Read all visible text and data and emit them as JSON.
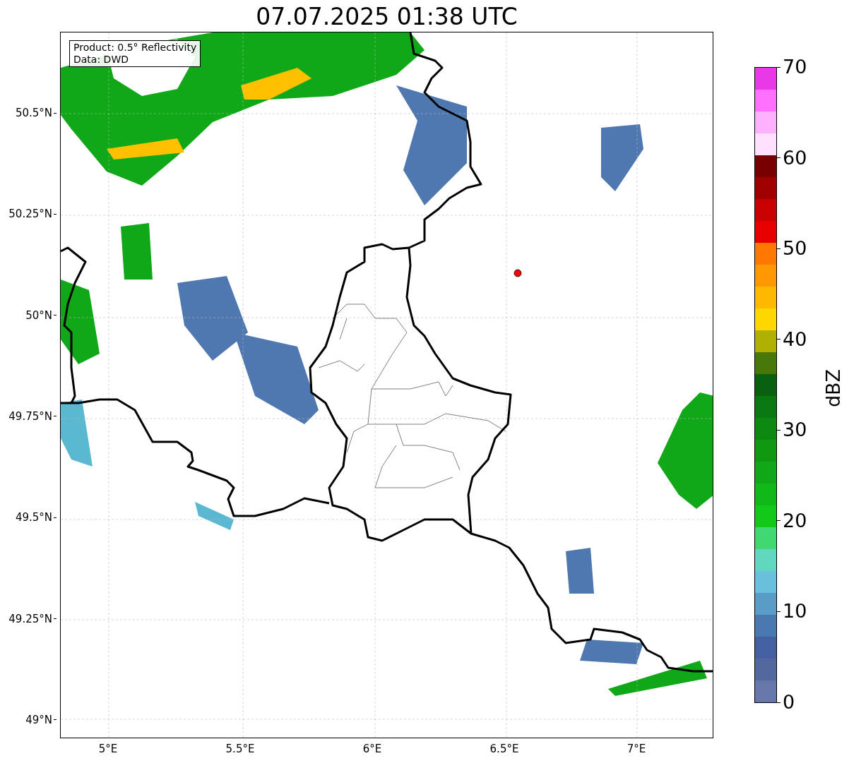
{
  "title": "07.07.2025 01:38 UTC",
  "annotation": [
    "Product: 0.5° Reflectivity",
    "Data: DWD"
  ],
  "map": {
    "y_ticks": [
      "50.5°N",
      "50.25°N",
      "50°N",
      "49.75°N",
      "49.5°N",
      "49.25°N",
      "49°N"
    ],
    "x_ticks": [
      "5°E",
      "5.5°E",
      "6°E",
      "6.5°E",
      "7°E"
    ]
  },
  "colorbar": {
    "label": "dBZ",
    "ticks": [
      "70",
      "60",
      "50",
      "40",
      "30",
      "20",
      "10",
      "0"
    ],
    "bins": [
      {
        "color": "#e838e8"
      },
      {
        "color": "#ff70ff"
      },
      {
        "color": "#ffb0ff"
      },
      {
        "color": "#ffe0ff"
      },
      {
        "color": "#780000"
      },
      {
        "color": "#a00000"
      },
      {
        "color": "#c80000"
      },
      {
        "color": "#e80000"
      },
      {
        "color": "#ff7800"
      },
      {
        "color": "#ff9800"
      },
      {
        "color": "#ffb800"
      },
      {
        "color": "#ffd800"
      },
      {
        "color": "#b0b000"
      },
      {
        "color": "#487808"
      },
      {
        "color": "#086010"
      },
      {
        "color": "#087810"
      },
      {
        "color": "#0c8810"
      },
      {
        "color": "#109810"
      },
      {
        "color": "#10a818"
      },
      {
        "color": "#10b818"
      },
      {
        "color": "#10c818"
      },
      {
        "color": "#40d870"
      },
      {
        "color": "#60d8c0"
      },
      {
        "color": "#68c0dc"
      },
      {
        "color": "#5a9cc8"
      },
      {
        "color": "#4a78b0"
      },
      {
        "color": "#4560a0"
      },
      {
        "color": "#5468a0"
      },
      {
        "color": "#6677aa"
      }
    ]
  }
}
